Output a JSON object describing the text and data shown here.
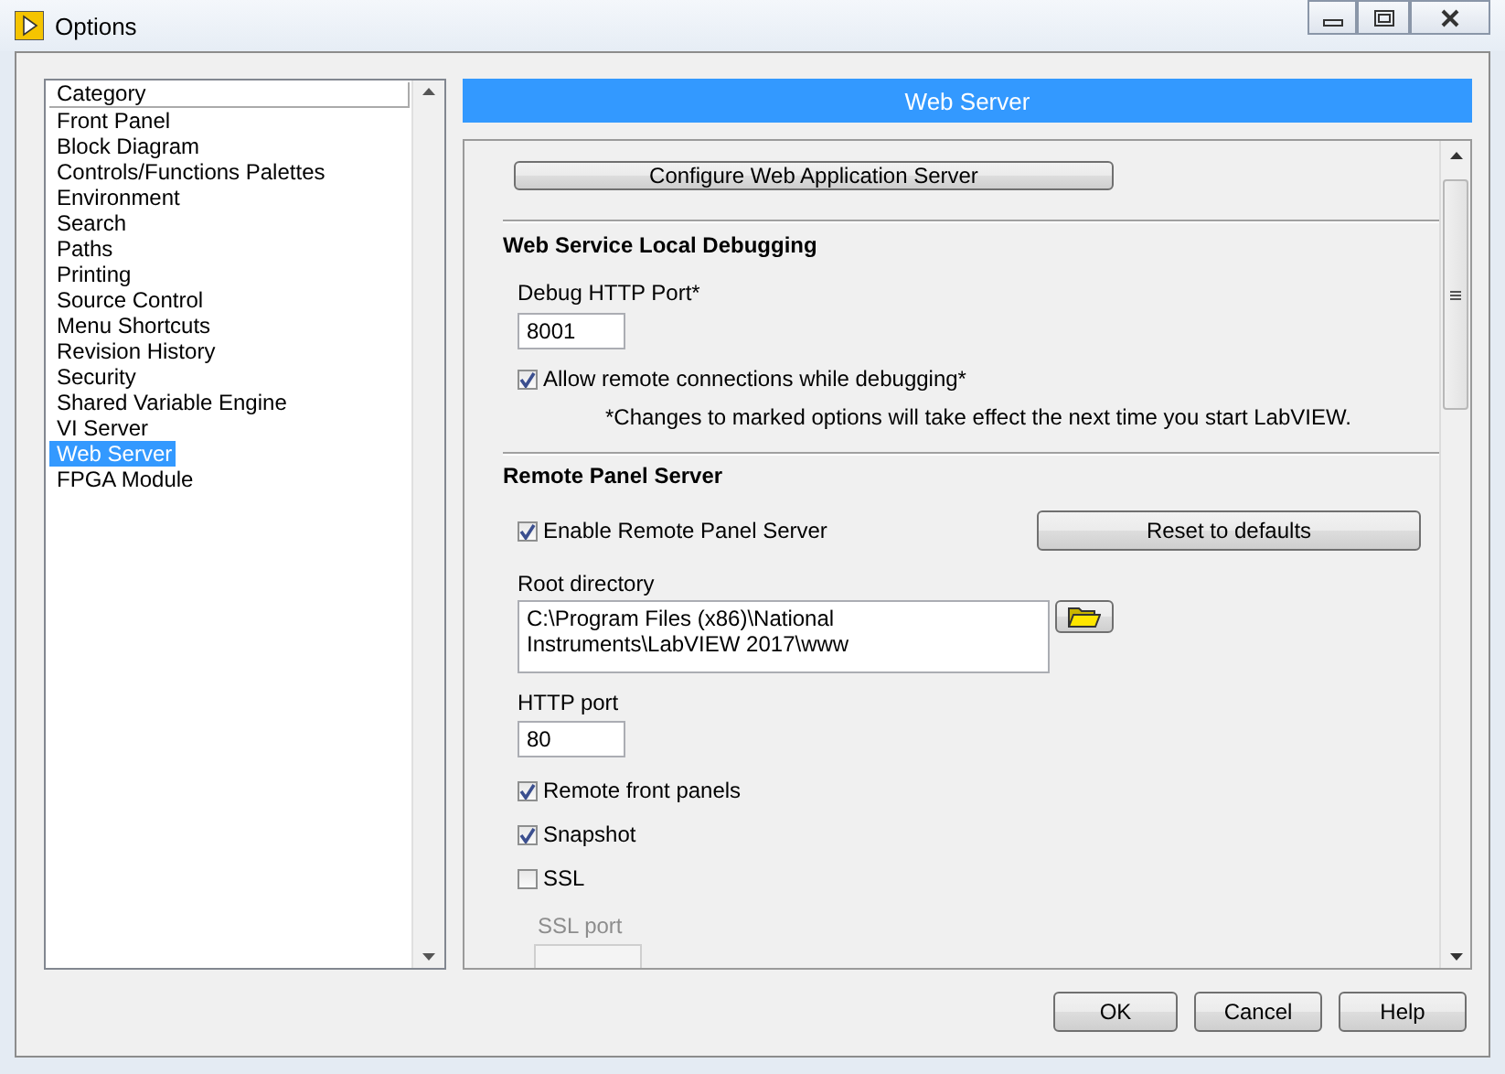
{
  "window": {
    "title": "Options"
  },
  "category_list": {
    "header": "Category",
    "items": [
      {
        "label": "Front Panel",
        "selected": false
      },
      {
        "label": "Block Diagram",
        "selected": false
      },
      {
        "label": "Controls/Functions Palettes",
        "selected": false
      },
      {
        "label": "Environment",
        "selected": false
      },
      {
        "label": "Search",
        "selected": false
      },
      {
        "label": "Paths",
        "selected": false
      },
      {
        "label": "Printing",
        "selected": false
      },
      {
        "label": "Source Control",
        "selected": false
      },
      {
        "label": "Menu Shortcuts",
        "selected": false
      },
      {
        "label": "Revision History",
        "selected": false
      },
      {
        "label": "Security",
        "selected": false
      },
      {
        "label": "Shared Variable Engine",
        "selected": false
      },
      {
        "label": "VI Server",
        "selected": false
      },
      {
        "label": "Web Server",
        "selected": true
      },
      {
        "label": "FPGA Module",
        "selected": false
      }
    ]
  },
  "panel": {
    "title": "Web Server",
    "configure_button": "Configure Web Application Server",
    "debugging": {
      "heading": "Web Service Local Debugging",
      "port_label": "Debug HTTP Port*",
      "port_value": "8001",
      "allow_remote": {
        "label": "Allow remote connections while debugging*",
        "checked": true
      },
      "note": "*Changes to marked options will take effect the next time you start LabVIEW."
    },
    "remote_panel": {
      "heading": "Remote Panel Server",
      "enable": {
        "label": "Enable Remote Panel Server",
        "checked": true
      },
      "reset_button": "Reset to defaults",
      "root_label": "Root directory",
      "root_value": "C:\\Program Files (x86)\\National Instruments\\LabVIEW 2017\\www",
      "http_label": "HTTP port",
      "http_value": "80",
      "options": [
        {
          "label": "Remote front panels",
          "checked": true
        },
        {
          "label": "Snapshot",
          "checked": true
        },
        {
          "label": "SSL",
          "checked": false
        }
      ],
      "ssl_port": {
        "label": "SSL port",
        "disabled": true
      }
    }
  },
  "buttons": [
    "OK",
    "Cancel",
    "Help"
  ]
}
